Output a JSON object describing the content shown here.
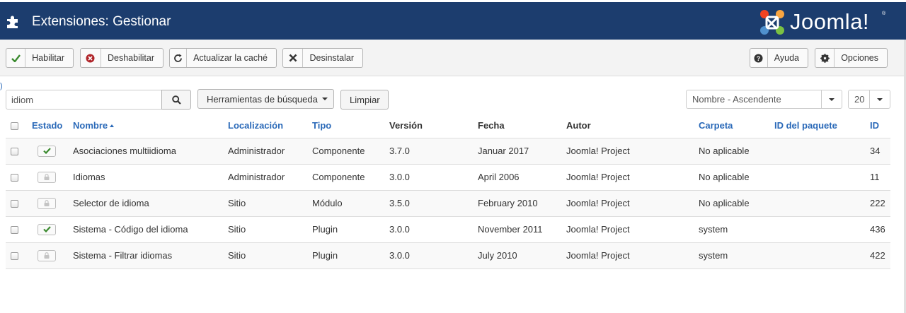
{
  "header": {
    "title": "Extensiones: Gestionar",
    "logo_text": "Joomla!",
    "logo_registered": "®",
    "page_icon": "puzzle-icon"
  },
  "toolbar": {
    "enable_label": "Habilitar",
    "disable_label": "Deshabilitar",
    "refresh_cache_label": "Actualizar la caché",
    "uninstall_label": "Desinstalar",
    "help_label": "Ayuda",
    "options_label": "Opciones"
  },
  "filters": {
    "search_value": "idiom",
    "search_tools_label": "Herramientas de búsqueda",
    "clear_label": "Limpiar",
    "ordering_value": "Nombre - Ascendente",
    "limit_value": "20"
  },
  "table": {
    "columns": {
      "status": "Estado",
      "name": "Nombre",
      "location": "Localización",
      "type": "Tipo",
      "version": "Versión",
      "date": "Fecha",
      "author": "Autor",
      "folder": "Carpeta",
      "package_id": "ID del paquete",
      "id": "ID"
    },
    "rows": [
      {
        "status": "enabled",
        "name": "Asociaciones multiidioma",
        "location": "Administrador",
        "type": "Componente",
        "version": "3.7.0",
        "date": "Januar 2017",
        "author": "Joomla! Project",
        "folder": "No aplicable",
        "package_id": "",
        "id": "34"
      },
      {
        "status": "locked",
        "name": "Idiomas",
        "location": "Administrador",
        "type": "Componente",
        "version": "3.0.0",
        "date": "April 2006",
        "author": "Joomla! Project",
        "folder": "No aplicable",
        "package_id": "",
        "id": "11"
      },
      {
        "status": "locked",
        "name": "Selector de idioma",
        "location": "Sitio",
        "type": "Módulo",
        "version": "3.5.0",
        "date": "February 2010",
        "author": "Joomla! Project",
        "folder": "No aplicable",
        "package_id": "",
        "id": "222"
      },
      {
        "status": "enabled",
        "name": "Sistema - Código del idioma",
        "location": "Sitio",
        "type": "Plugin",
        "version": "3.0.0",
        "date": "November 2011",
        "author": "Joomla! Project",
        "folder": "system",
        "package_id": "",
        "id": "436"
      },
      {
        "status": "locked",
        "name": "Sistema - Filtrar idiomas",
        "location": "Sitio",
        "type": "Plugin",
        "version": "3.0.0",
        "date": "July 2010",
        "author": "Joomla! Project",
        "folder": "system",
        "package_id": "",
        "id": "422"
      }
    ]
  },
  "colors": {
    "header_bg": "#1c3d6e",
    "link": "#2a69b8",
    "enabled_check": "#3a8a2e",
    "disable_icon": "#b0252a"
  }
}
